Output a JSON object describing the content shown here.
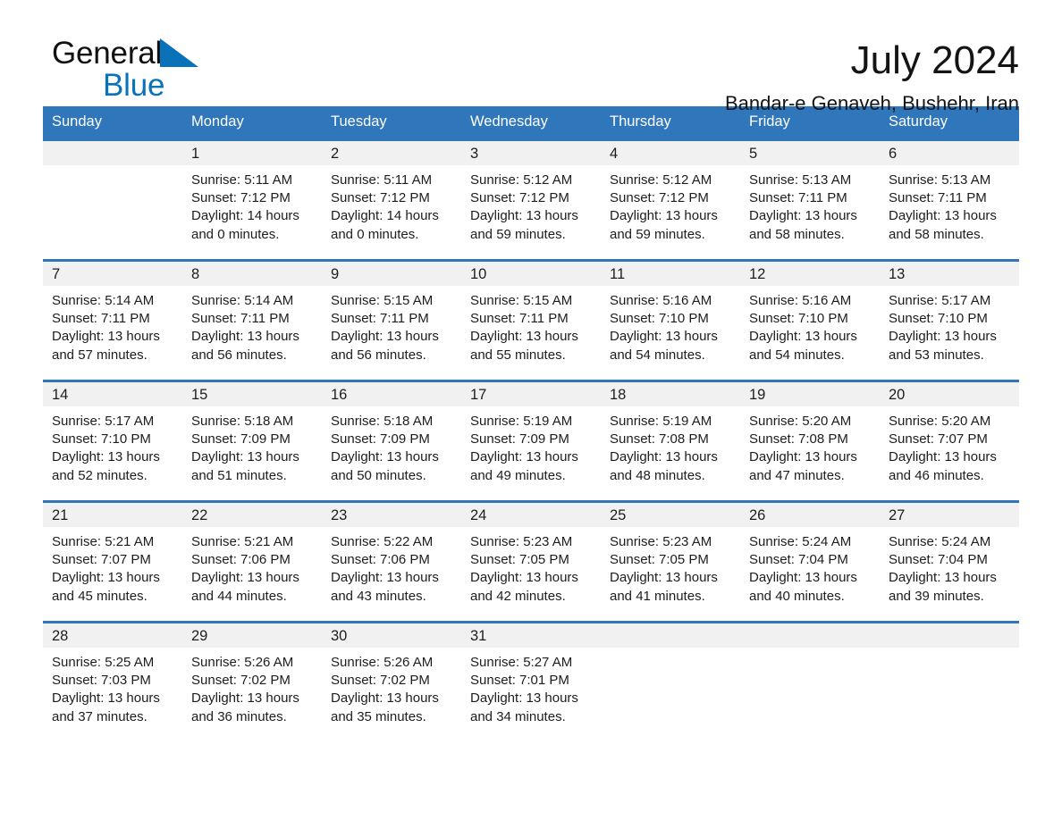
{
  "brand": {
    "name_part1": "General",
    "name_part2": "Blue",
    "accent_color": "#0a72b8"
  },
  "header": {
    "title": "July 2024",
    "subtitle": "Bandar-e Genaveh, Bushehr, Iran"
  },
  "calendar": {
    "header_color": "#2f76ba",
    "daynum_band_color": "#f1f1f1",
    "weekday_headers": [
      "Sunday",
      "Monday",
      "Tuesday",
      "Wednesday",
      "Thursday",
      "Friday",
      "Saturday"
    ],
    "weeks": [
      [
        {
          "day": "",
          "empty": true
        },
        {
          "day": "1",
          "sunrise": "Sunrise: 5:11 AM",
          "sunset": "Sunset: 7:12 PM",
          "daylight_line1": "Daylight: 14 hours",
          "daylight_line2": "and 0 minutes."
        },
        {
          "day": "2",
          "sunrise": "Sunrise: 5:11 AM",
          "sunset": "Sunset: 7:12 PM",
          "daylight_line1": "Daylight: 14 hours",
          "daylight_line2": "and 0 minutes."
        },
        {
          "day": "3",
          "sunrise": "Sunrise: 5:12 AM",
          "sunset": "Sunset: 7:12 PM",
          "daylight_line1": "Daylight: 13 hours",
          "daylight_line2": "and 59 minutes."
        },
        {
          "day": "4",
          "sunrise": "Sunrise: 5:12 AM",
          "sunset": "Sunset: 7:12 PM",
          "daylight_line1": "Daylight: 13 hours",
          "daylight_line2": "and 59 minutes."
        },
        {
          "day": "5",
          "sunrise": "Sunrise: 5:13 AM",
          "sunset": "Sunset: 7:11 PM",
          "daylight_line1": "Daylight: 13 hours",
          "daylight_line2": "and 58 minutes."
        },
        {
          "day": "6",
          "sunrise": "Sunrise: 5:13 AM",
          "sunset": "Sunset: 7:11 PM",
          "daylight_line1": "Daylight: 13 hours",
          "daylight_line2": "and 58 minutes."
        }
      ],
      [
        {
          "day": "7",
          "sunrise": "Sunrise: 5:14 AM",
          "sunset": "Sunset: 7:11 PM",
          "daylight_line1": "Daylight: 13 hours",
          "daylight_line2": "and 57 minutes."
        },
        {
          "day": "8",
          "sunrise": "Sunrise: 5:14 AM",
          "sunset": "Sunset: 7:11 PM",
          "daylight_line1": "Daylight: 13 hours",
          "daylight_line2": "and 56 minutes."
        },
        {
          "day": "9",
          "sunrise": "Sunrise: 5:15 AM",
          "sunset": "Sunset: 7:11 PM",
          "daylight_line1": "Daylight: 13 hours",
          "daylight_line2": "and 56 minutes."
        },
        {
          "day": "10",
          "sunrise": "Sunrise: 5:15 AM",
          "sunset": "Sunset: 7:11 PM",
          "daylight_line1": "Daylight: 13 hours",
          "daylight_line2": "and 55 minutes."
        },
        {
          "day": "11",
          "sunrise": "Sunrise: 5:16 AM",
          "sunset": "Sunset: 7:10 PM",
          "daylight_line1": "Daylight: 13 hours",
          "daylight_line2": "and 54 minutes."
        },
        {
          "day": "12",
          "sunrise": "Sunrise: 5:16 AM",
          "sunset": "Sunset: 7:10 PM",
          "daylight_line1": "Daylight: 13 hours",
          "daylight_line2": "and 54 minutes."
        },
        {
          "day": "13",
          "sunrise": "Sunrise: 5:17 AM",
          "sunset": "Sunset: 7:10 PM",
          "daylight_line1": "Daylight: 13 hours",
          "daylight_line2": "and 53 minutes."
        }
      ],
      [
        {
          "day": "14",
          "sunrise": "Sunrise: 5:17 AM",
          "sunset": "Sunset: 7:10 PM",
          "daylight_line1": "Daylight: 13 hours",
          "daylight_line2": "and 52 minutes."
        },
        {
          "day": "15",
          "sunrise": "Sunrise: 5:18 AM",
          "sunset": "Sunset: 7:09 PM",
          "daylight_line1": "Daylight: 13 hours",
          "daylight_line2": "and 51 minutes."
        },
        {
          "day": "16",
          "sunrise": "Sunrise: 5:18 AM",
          "sunset": "Sunset: 7:09 PM",
          "daylight_line1": "Daylight: 13 hours",
          "daylight_line2": "and 50 minutes."
        },
        {
          "day": "17",
          "sunrise": "Sunrise: 5:19 AM",
          "sunset": "Sunset: 7:09 PM",
          "daylight_line1": "Daylight: 13 hours",
          "daylight_line2": "and 49 minutes."
        },
        {
          "day": "18",
          "sunrise": "Sunrise: 5:19 AM",
          "sunset": "Sunset: 7:08 PM",
          "daylight_line1": "Daylight: 13 hours",
          "daylight_line2": "and 48 minutes."
        },
        {
          "day": "19",
          "sunrise": "Sunrise: 5:20 AM",
          "sunset": "Sunset: 7:08 PM",
          "daylight_line1": "Daylight: 13 hours",
          "daylight_line2": "and 47 minutes."
        },
        {
          "day": "20",
          "sunrise": "Sunrise: 5:20 AM",
          "sunset": "Sunset: 7:07 PM",
          "daylight_line1": "Daylight: 13 hours",
          "daylight_line2": "and 46 minutes."
        }
      ],
      [
        {
          "day": "21",
          "sunrise": "Sunrise: 5:21 AM",
          "sunset": "Sunset: 7:07 PM",
          "daylight_line1": "Daylight: 13 hours",
          "daylight_line2": "and 45 minutes."
        },
        {
          "day": "22",
          "sunrise": "Sunrise: 5:21 AM",
          "sunset": "Sunset: 7:06 PM",
          "daylight_line1": "Daylight: 13 hours",
          "daylight_line2": "and 44 minutes."
        },
        {
          "day": "23",
          "sunrise": "Sunrise: 5:22 AM",
          "sunset": "Sunset: 7:06 PM",
          "daylight_line1": "Daylight: 13 hours",
          "daylight_line2": "and 43 minutes."
        },
        {
          "day": "24",
          "sunrise": "Sunrise: 5:23 AM",
          "sunset": "Sunset: 7:05 PM",
          "daylight_line1": "Daylight: 13 hours",
          "daylight_line2": "and 42 minutes."
        },
        {
          "day": "25",
          "sunrise": "Sunrise: 5:23 AM",
          "sunset": "Sunset: 7:05 PM",
          "daylight_line1": "Daylight: 13 hours",
          "daylight_line2": "and 41 minutes."
        },
        {
          "day": "26",
          "sunrise": "Sunrise: 5:24 AM",
          "sunset": "Sunset: 7:04 PM",
          "daylight_line1": "Daylight: 13 hours",
          "daylight_line2": "and 40 minutes."
        },
        {
          "day": "27",
          "sunrise": "Sunrise: 5:24 AM",
          "sunset": "Sunset: 7:04 PM",
          "daylight_line1": "Daylight: 13 hours",
          "daylight_line2": "and 39 minutes."
        }
      ],
      [
        {
          "day": "28",
          "sunrise": "Sunrise: 5:25 AM",
          "sunset": "Sunset: 7:03 PM",
          "daylight_line1": "Daylight: 13 hours",
          "daylight_line2": "and 37 minutes."
        },
        {
          "day": "29",
          "sunrise": "Sunrise: 5:26 AM",
          "sunset": "Sunset: 7:02 PM",
          "daylight_line1": "Daylight: 13 hours",
          "daylight_line2": "and 36 minutes."
        },
        {
          "day": "30",
          "sunrise": "Sunrise: 5:26 AM",
          "sunset": "Sunset: 7:02 PM",
          "daylight_line1": "Daylight: 13 hours",
          "daylight_line2": "and 35 minutes."
        },
        {
          "day": "31",
          "sunrise": "Sunrise: 5:27 AM",
          "sunset": "Sunset: 7:01 PM",
          "daylight_line1": "Daylight: 13 hours",
          "daylight_line2": "and 34 minutes."
        },
        {
          "day": "",
          "empty": true
        },
        {
          "day": "",
          "empty": true
        },
        {
          "day": "",
          "empty": true
        }
      ]
    ]
  }
}
